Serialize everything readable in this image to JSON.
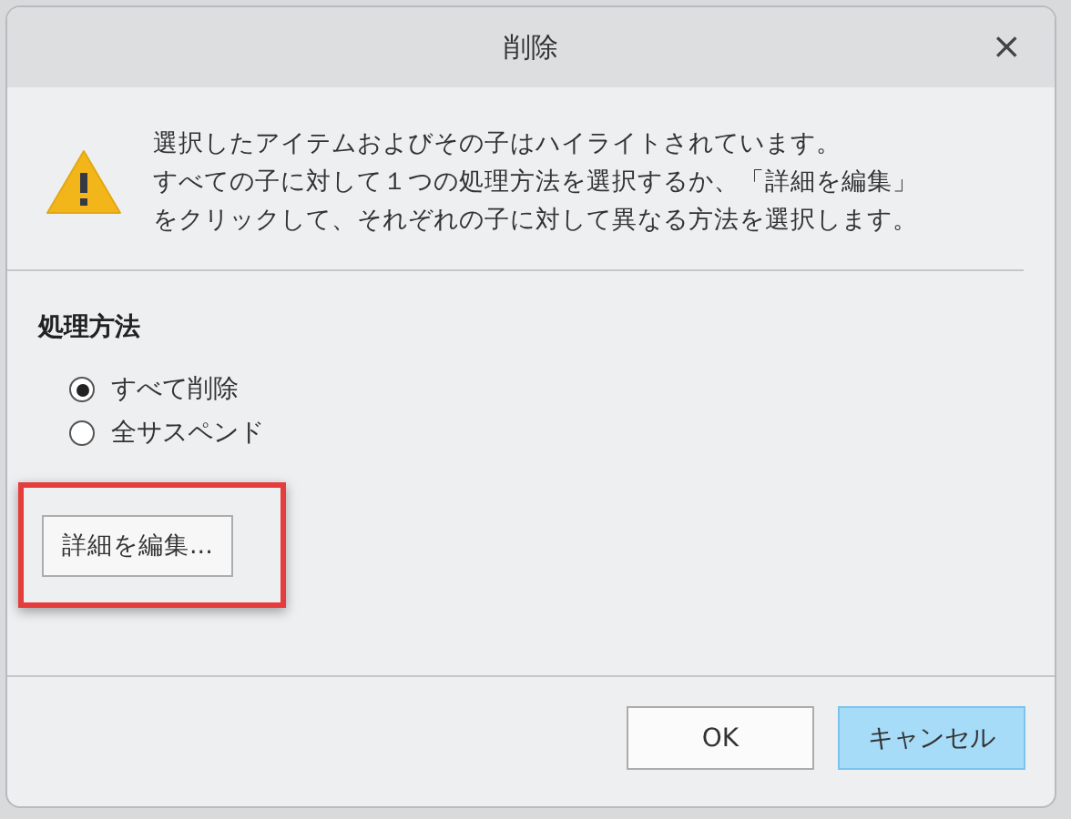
{
  "window": {
    "title": "削除",
    "close": "×"
  },
  "message": {
    "lines": [
      "選択したアイテムおよびその子はハイライトされています。",
      "すべての子に対して１つの処理方法を選択するか、「詳細を編集」",
      "をクリックして、それぞれの子に対して異なる方法を選択します。"
    ]
  },
  "section": {
    "label": "処理方法"
  },
  "options": [
    {
      "label": "すべて削除",
      "selected": true
    },
    {
      "label": "全サスペンド",
      "selected": false
    }
  ],
  "edit_button": {
    "label": "詳細を編集...",
    "highlighted": true
  },
  "buttons": [
    {
      "label": "OK",
      "default": false
    },
    {
      "label": "キャンセル",
      "default": true
    }
  ]
}
